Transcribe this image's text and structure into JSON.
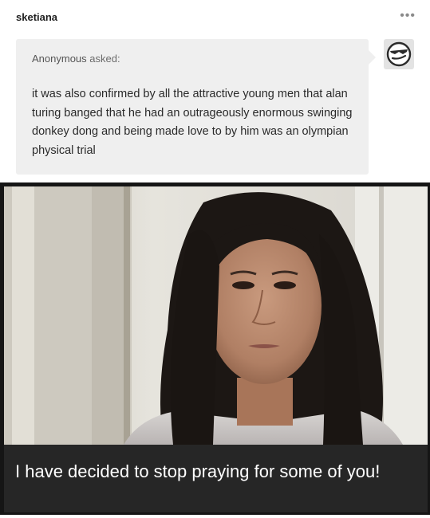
{
  "post": {
    "blog_name": "sketiana",
    "more_icon": "ellipsis-icon",
    "more_label": "•••"
  },
  "ask": {
    "asker": "Anonymous",
    "asked_label": "asked:",
    "question": "it was also confirmed by all the attractive young men that alan turing banged that he had an outrageously enormous swinging donkey dong and being made love to by him was an olympian physical trial",
    "bubble_color": "#efefef"
  },
  "answerer_avatar": {
    "icon": "cool-sunglasses-face-icon"
  },
  "image": {
    "caption": "I have decided to stop praying for some of you!",
    "caption_bar_color": "#262626"
  }
}
